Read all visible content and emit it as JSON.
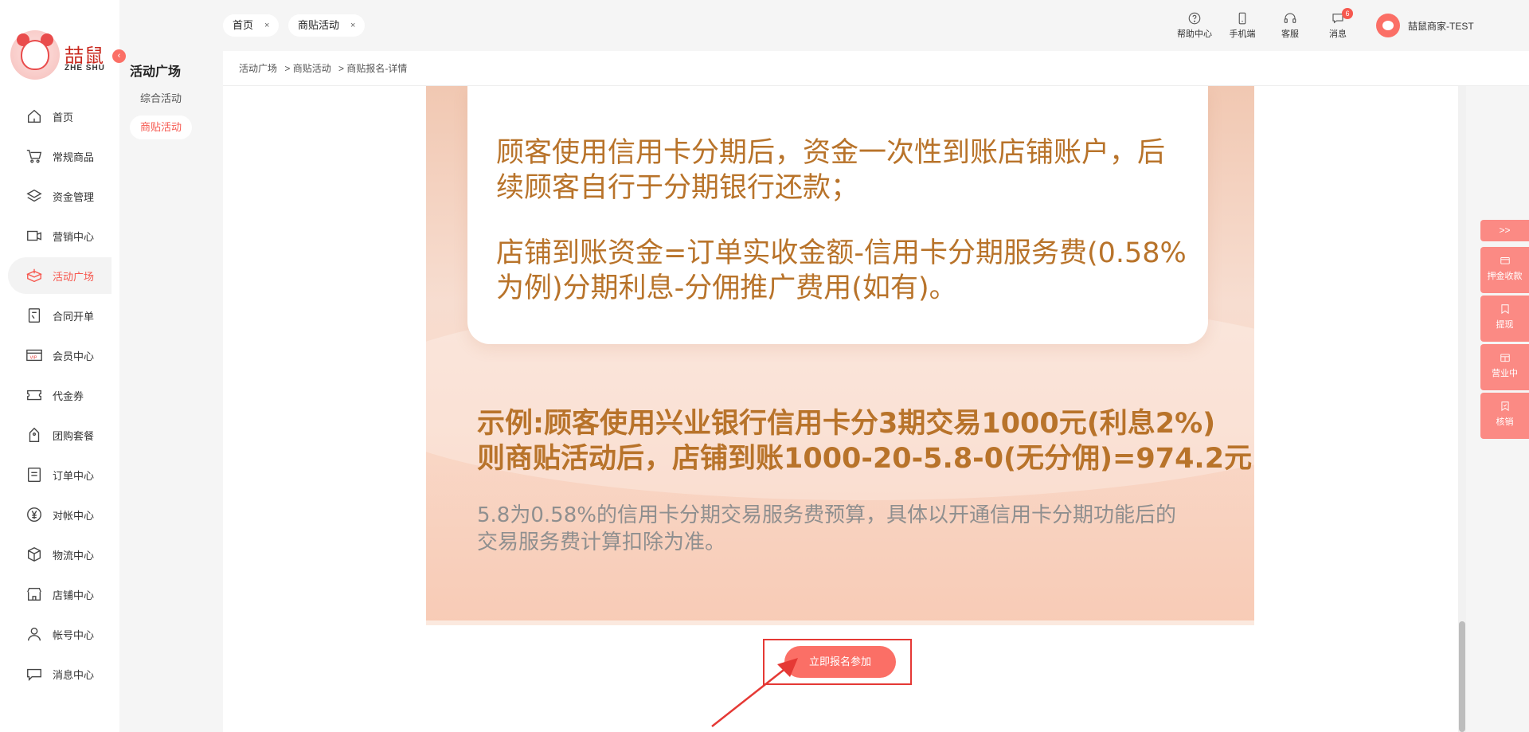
{
  "brand": {
    "name_cn": "喆鼠",
    "name_en": "ZHE SHU"
  },
  "sidebar": {
    "items": [
      {
        "label": "首页",
        "icon": "home-icon"
      },
      {
        "label": "常规商品",
        "icon": "cart-icon"
      },
      {
        "label": "资金管理",
        "icon": "layers-icon"
      },
      {
        "label": "营销中心",
        "icon": "marketing-icon"
      },
      {
        "label": "活动广场",
        "icon": "activity-box-icon",
        "active": true
      },
      {
        "label": "合同开单",
        "icon": "contract-icon"
      },
      {
        "label": "会员中心",
        "icon": "vip-card-icon"
      },
      {
        "label": "代金券",
        "icon": "coupon-icon"
      },
      {
        "label": "团购套餐",
        "icon": "group-buy-icon"
      },
      {
        "label": "订单中心",
        "icon": "order-icon"
      },
      {
        "label": "对帐中心",
        "icon": "yen-icon"
      },
      {
        "label": "物流中心",
        "icon": "package-icon"
      },
      {
        "label": "店铺中心",
        "icon": "store-icon"
      },
      {
        "label": "帐号中心",
        "icon": "user-icon"
      },
      {
        "label": "消息中心",
        "icon": "message-icon"
      }
    ]
  },
  "submenu": {
    "title": "活动广场",
    "items": [
      {
        "label": "综合活动"
      },
      {
        "label": "商贴活动",
        "active": true
      }
    ]
  },
  "tabs": [
    {
      "label": "首页",
      "close": "×"
    },
    {
      "label": "商贴活动",
      "close": "×"
    }
  ],
  "toolbar": {
    "help": "帮助中心",
    "mobile": "手机端",
    "service": "客服",
    "messages": "消息",
    "message_count": "6",
    "user_name": "喆鼠商家-TEST"
  },
  "breadcrumb": [
    "活动广场",
    "> 商贴活动",
    "> 商贴报名-详情"
  ],
  "poster": {
    "card_para1": "顾客使用信用卡分期后，资金一次性到账店铺账户，后续顾客自行于分期银行还款；",
    "card_para2": "店铺到账资金=订单实收金额-信用卡分期服务费(0.58%为例)分期利息-分佣推广费用(如有)。",
    "example_line1": "示例:顾客使用兴业银行信用卡分3期交易1000元(利息2%)",
    "example_line2": "则商贴活动后，店铺到账1000-20-5.8-0(无分佣)=974.2元",
    "note": "5.8为0.58%的信用卡分期交易服务费预算，具体以开通信用卡分期功能后的交易服务费计算扣除为准。"
  },
  "join_button": "立即报名参加",
  "right_tools": {
    "toggle": ">>",
    "items": [
      {
        "label": "押金收款"
      },
      {
        "label": "提现"
      },
      {
        "label": "营业中"
      },
      {
        "label": "核销"
      }
    ]
  },
  "colors": {
    "accent": "#f6584f",
    "button": "#fb6f66",
    "poster_text": "#b8732a",
    "highlight_box": "#e53935"
  }
}
